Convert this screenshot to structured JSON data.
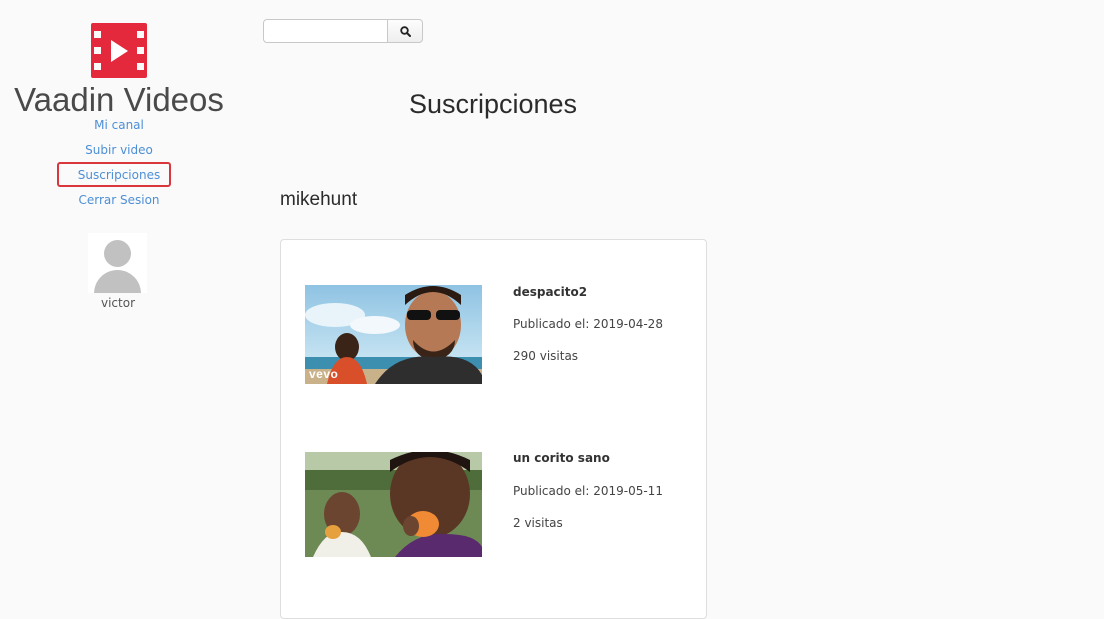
{
  "app": {
    "title": "Vaadin Videos"
  },
  "sidebar": {
    "links": [
      {
        "label": "Mi canal"
      },
      {
        "label": "Subir video"
      },
      {
        "label": "Suscripciones"
      },
      {
        "label": "Cerrar Sesion"
      }
    ],
    "user": {
      "name": "victor"
    }
  },
  "search": {
    "value": "",
    "placeholder": ""
  },
  "main": {
    "title": "Suscripciones",
    "channel": "mikehunt",
    "videos": [
      {
        "title": "despacito2",
        "published": "Publicado el: 2019-04-28",
        "views": "290 visitas",
        "thumb_overlay": "vevo"
      },
      {
        "title": "un corito sano",
        "published": "Publicado el: 2019-05-11",
        "views": "2 visitas"
      }
    ]
  },
  "colors": {
    "brand": "#e5293d",
    "link": "#4d8fd6",
    "selected_outline": "#d9363e"
  }
}
